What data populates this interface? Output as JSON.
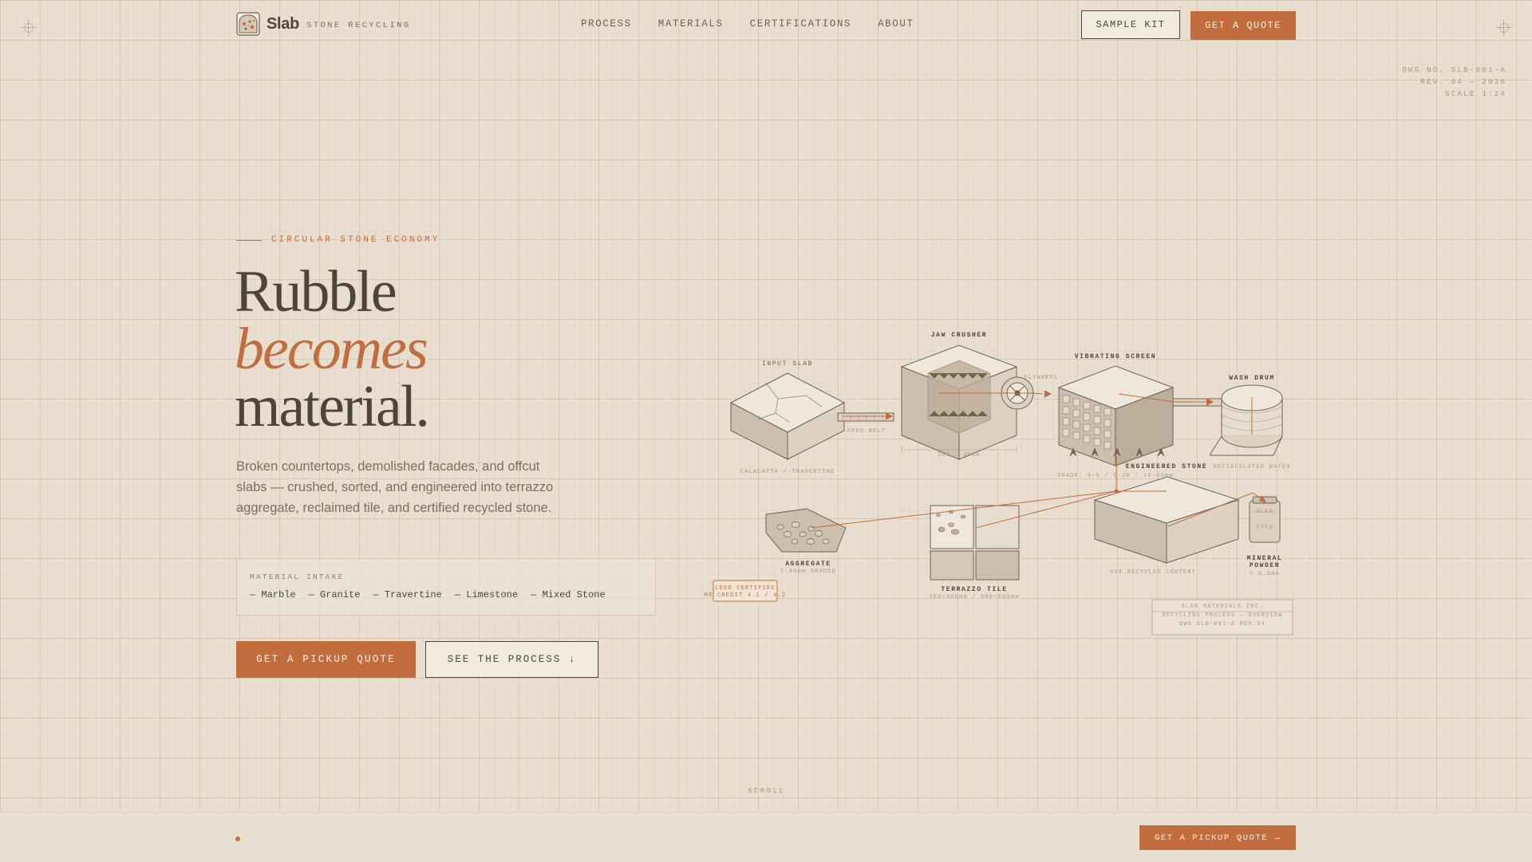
{
  "brand": {
    "name": "Slab",
    "tagline": "STONE RECYCLING"
  },
  "nav": {
    "items": [
      "PROCESS",
      "MATERIALS",
      "CERTIFICATIONS",
      "ABOUT"
    ]
  },
  "header_actions": {
    "sample_kit": "SAMPLE KIT",
    "get_quote": "GET A QUOTE"
  },
  "drawing_meta": {
    "line1": "DWG NO. SLB-001-A",
    "line2": "REV. 04 — 2026",
    "line3": "SCALE 1:24"
  },
  "hero": {
    "eyebrow": "CIRCULAR STONE ECONOMY",
    "headline_1": "Rubble",
    "headline_2": "becomes",
    "headline_3": "material.",
    "lede": "Broken countertops, demolished facades, and offcut slabs — crushed, sorted, and engineered into terrazzo aggregate, reclaimed tile, and certified recycled stone.",
    "intake_label": "MATERIAL INTAKE",
    "intake_items": [
      "— Marble",
      "— Granite",
      "— Travertine",
      "— Limestone",
      "— Mixed Stone"
    ],
    "primary_cta": "GET A PICKUP QUOTE",
    "secondary_cta": "SEE THE PROCESS ↓"
  },
  "diagram": {
    "input_slab": "INPUT SLAB",
    "input_slab_sub": "CALACATTA / TRAVERTINE",
    "feed_belt": "FEED BELT",
    "jaw_crusher": "JAW CRUSHER",
    "jaw_crusher_sub": "200 — 40mm",
    "flywheel": "FLYWHEEL",
    "vibrating_screen": "VIBRATING SCREEN",
    "screen_sub": "GRADE: 0-5 / 5-20 / 20-40mm",
    "wash_drum": "WASH DRUM",
    "wash_sub": "RECIRCULATED WATER",
    "aggregate": "AGGREGATE",
    "aggregate_sub": "2-40mm GRADED",
    "terrazzo": "TERRAZZO TILE",
    "terrazzo_sub": "300×300mm / 600×600mm",
    "engineered": "ENGINEERED STONE",
    "engineered_sub": "95% RECYCLED CONTENT",
    "powder_1": "MINERAL",
    "powder_2": "POWDER",
    "powder_sub": "< 0.5mm",
    "powder_bag_1": "SLAB",
    "powder_bag_2": "25kg",
    "leed_1": "LEED CERTIFIED",
    "leed_2": "MR CREDIT 4.1 / 4.2",
    "titleblock_1": "SLAB MATERIALS INC.",
    "titleblock_2": "RECYCLING PROCESS — OVERVIEW",
    "titleblock_3": "DWG SLB-001-A REV.04"
  },
  "scroll_label": "SCROLL",
  "bottom_cta": "GET A PICKUP QUOTE →",
  "colors": {
    "accent": "#c26d3d",
    "ink": "#4f4438",
    "paper": "#e9dfd0"
  }
}
